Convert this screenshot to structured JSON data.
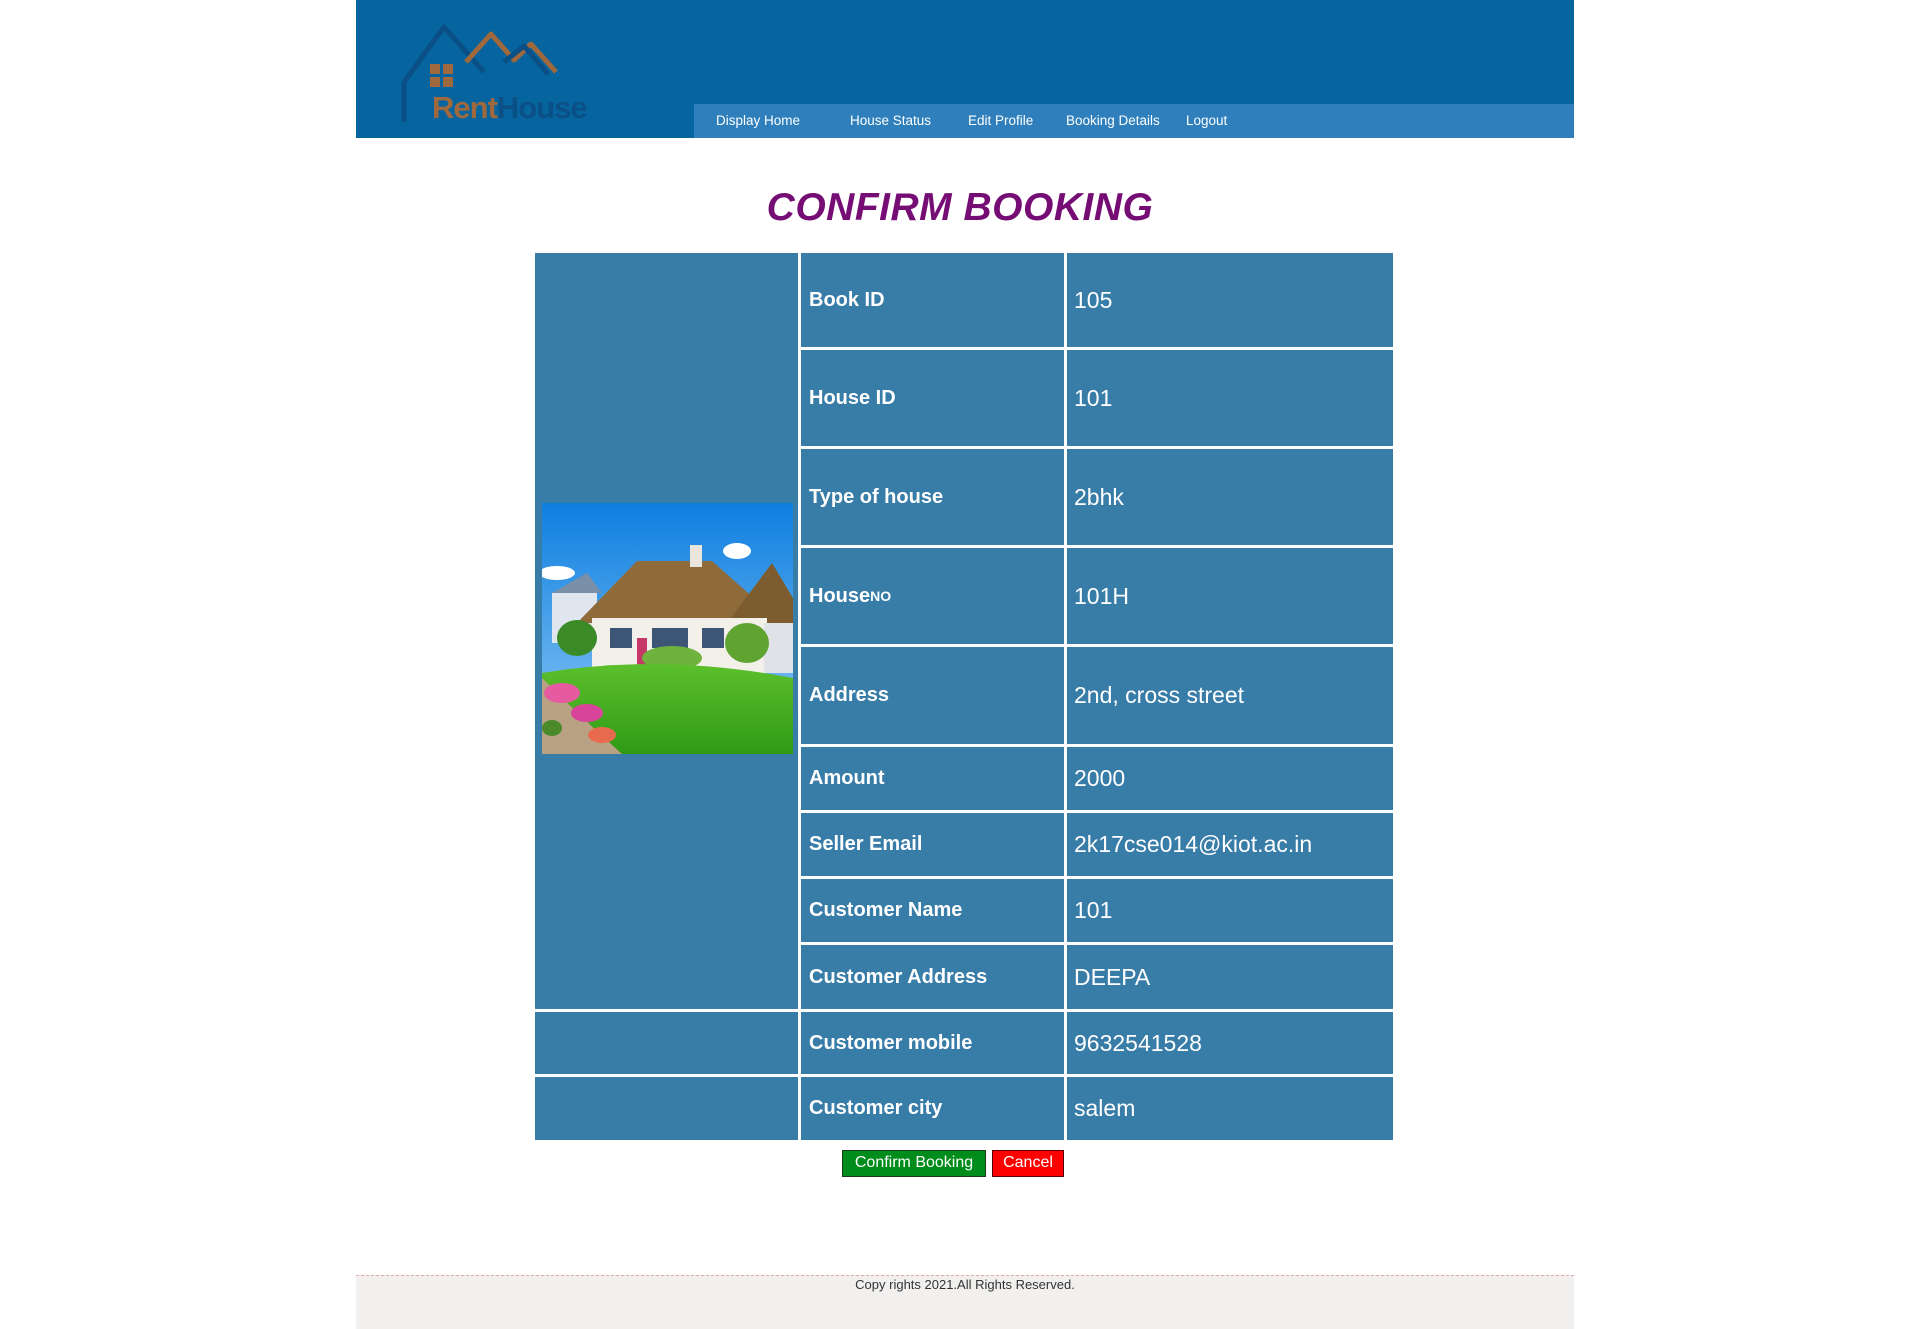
{
  "app": {
    "logo": {
      "rent": "Rent",
      "house": "House"
    }
  },
  "nav": [
    {
      "label": "Display Home"
    },
    {
      "label": "House Status"
    },
    {
      "label": "Edit Profile"
    },
    {
      "label": "Booking Details"
    },
    {
      "label": "Logout"
    }
  ],
  "title": "CONFIRM BOOKING",
  "rows": [
    {
      "label": "Book ID",
      "value": "105"
    },
    {
      "label": "House ID",
      "value": "101"
    },
    {
      "label": "Type of house",
      "value": "2bhk"
    },
    {
      "label": "House",
      "label_small": "NO",
      "value": "101H"
    },
    {
      "label": "Address",
      "value": "2nd, cross street"
    },
    {
      "label": "Amount",
      "value": "2000"
    },
    {
      "label": "Seller Email",
      "value": "2k17cse014@kiot.ac.in"
    },
    {
      "label": "Customer Name",
      "value": "101"
    },
    {
      "label": "Customer Address",
      "value": "DEEPA"
    },
    {
      "label": "Customer mobile",
      "value": "9632541528"
    },
    {
      "label": "Customer city",
      "value": "salem"
    }
  ],
  "buttons": {
    "confirm": "Confirm Booking",
    "cancel": "Cancel"
  },
  "footer": {
    "text": "Copy rights 2021.All Rights Reserved."
  },
  "colors": {
    "header": "#06649e",
    "nav": "#2e7fbb",
    "cell": "#387ca8",
    "title": "#750d75",
    "confirm": "#008c1a",
    "cancel": "#ff0000"
  }
}
